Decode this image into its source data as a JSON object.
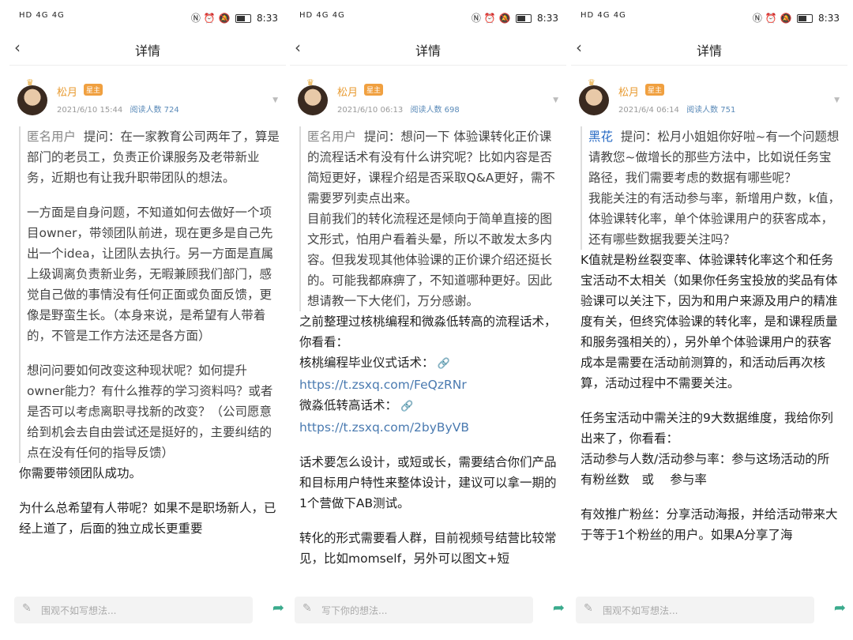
{
  "status": {
    "signal": "HD 4G 4G",
    "time": "8:33",
    "icons": [
      "nfc-icon",
      "alarm-icon",
      "mute-icon",
      "battery-icon"
    ]
  },
  "nav": {
    "back_icon": "chevron-left-icon",
    "title": "详情"
  },
  "footer": {
    "share_icon": "share-icon",
    "pencil_icon": "pencil-icon"
  },
  "posts": [
    {
      "author": "松月",
      "badge": "星主",
      "date": "2021/6/10 15:44",
      "reads": "阅读人数 724",
      "placeholder": "围观不如写想法...",
      "quote_name": "匿名用户",
      "quote_lines": [
        "提问：在一家教育公司两年了，算是部门的老员工，负责正价课服务及老带新业务，近期也有让我升职带团队的想法。",
        "",
        "一方面是自身问题，不知道如何去做好一个项目owner，带领团队前进，现在更多是自己先出一个idea，让团队去执行。另一方面是直属上级调离负责新业务，无暇兼顾我们部门，感觉自己做的事情没有任何正面或负面反馈，更像是野蛮生长。（本身来说，是希望有人带着的，不管是工作方法还是各方面）",
        "",
        "想问问要如何改变这种现状呢？如何提升owner能力？有什么推荐的学习资料吗？或者是否可以考虑离职寻找新的改变？（公司愿意给到机会去自由尝试还是挺好的，主要纠结的点在没有任何的指导反馈）"
      ],
      "answer_lines": [
        "你需要带领团队成功。",
        "",
        "为什么总希望有人带呢？如果不是职场新人，已经上道了，后面的独立成长更重要"
      ]
    },
    {
      "author": "松月",
      "badge": "星主",
      "date": "2021/6/10 06:13",
      "reads": "阅读人数 698",
      "placeholder": "写下你的想法...",
      "quote_name": "匿名用户",
      "quote_lines": [
        "提问：想问一下 体验课转化正价课的流程话术有没有什么讲究呢？比如内容是否简短更好，课程介绍是否采取Q&A更好，需不需要罗列卖点出来。",
        "目前我们的转化流程还是倾向于简单直接的图文形式，怕用户看着头晕，所以不敢发太多内容。但我发现其他体验课的正价课介绍还挺长的。可能我都麻痹了，不知道哪种更好。因此想请教一下大佬们，万分感谢。"
      ],
      "answer_lines": [
        "之前整理过核桃编程和微淼低转高的流程话术，你看看：",
        "核桃编程毕业仪式话术：",
        "https://t.zsxq.com/FeQzRNr",
        "微淼低转高话术：",
        "https://t.zsxq.com/2byByVB",
        "",
        "话术要怎么设计，或短或长，需要结合你们产品和目标用户特性来整体设计，建议可以拿一期的1个营做下AB测试。",
        "",
        "转化的形式需要看人群，目前视频号结营比较常见，比如momself，另外可以图文+短"
      ]
    },
    {
      "author": "松月",
      "badge": "星主",
      "date": "2021/6/4 06:14",
      "reads": "阅读人数 751",
      "placeholder": "围观不如写想法...",
      "quote_name": "黑花",
      "quote_lines": [
        "提问：松月小姐姐你好啦~有一个问题想请教您~做增长的那些方法中，比如说任务宝路径，我们需要考虑的数据有哪些呢？",
        "我能关注的有活动参与率，新增用户数，k值，体验课转化率，单个体验课用户的获客成本，还有哪些数据我要关注吗？"
      ],
      "answer_lines": [
        "K值就是粉丝裂变率、体验课转化率这个和任务宝活动不太相关（如果你任务宝投放的奖品有体验课可以关注下，因为和用户来源及用户的精准度有关，但终究体验课的转化率，是和课程质量和服务强相关的），另外单个体验课用户的获客成本是需要在活动前测算的，和活动后再次核算，活动过程中不需要关注。",
        "",
        "任务宝活动中需关注的9大数据维度，我给你列出来了，你看看：",
        "活动参与人数/活动参与率：参与这场活动的所有粉丝数　或　 参与率",
        "",
        "有效推广粉丝：分享活动海报，并给活动带来大于等于1个粉丝的用户。如果A分享了海"
      ]
    }
  ]
}
